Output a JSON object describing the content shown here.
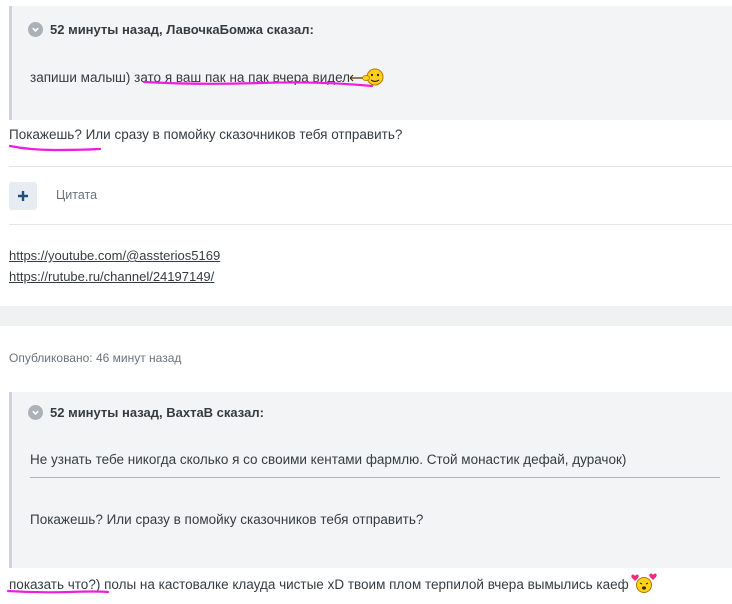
{
  "post1": {
    "quote": {
      "header": "52 минуты назад, ЛавочкаБомжа сказал:",
      "text_plain": "запиши малыш) ",
      "text_marked": "зато я ваш пак на пак вчера видел"
    },
    "reply_marked": "Покажешь?",
    "reply_rest": " Или сразу в помойку сказочников тебя отправить?",
    "quote_button_label": "Цитата",
    "signature_links": [
      "https://youtube.com/@assterios5169",
      "https://rutube.ru/channel/24197149/"
    ]
  },
  "post2": {
    "posted": "Опубликовано: 46 минут назад",
    "quote": {
      "header": "52 минуты назад, ВахтаВ сказал:",
      "line1": "Не узнать тебе никогда сколько я со своими кентами фармлю. Стой монастик дефай, дурачок)",
      "line2": "Покажешь? Или сразу в помойку сказочников тебя отправить?"
    },
    "reply_marked": "показать что?",
    "reply_rest": ") полы на кастовалке клауда чистые xD твоим плом терпилой вчера вымылись каеф"
  },
  "colors": {
    "highlight": "#ee1ee0",
    "background": "#f0f1f3",
    "card": "#ffffff",
    "quote_bg": "#f3f4f6"
  }
}
